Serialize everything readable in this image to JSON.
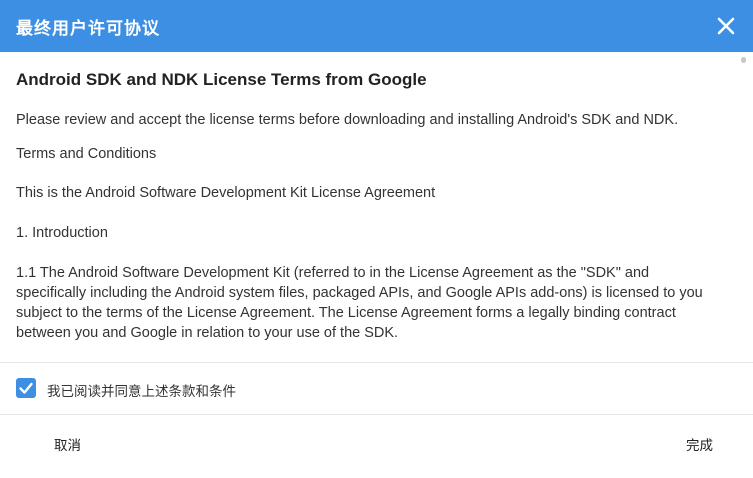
{
  "dialog": {
    "title": "最终用户许可协议",
    "close_icon": "close-icon"
  },
  "license": {
    "heading": "Android SDK and NDK License Terms from Google",
    "intro": "Please review and accept the license terms before downloading and installing Android's SDK and NDK.",
    "terms_title": "Terms and Conditions",
    "agreement_title": "This is the Android Software Development Kit License Agreement",
    "section_1": "1. Introduction",
    "section_1_1": "1.1 The Android Software Development Kit (referred to in the License Agreement as the \"SDK\" and specifically including the Android system files, packaged APIs, and Google APIs add-ons) is licensed to you subject to the terms of the License Agreement. The License Agreement forms a legally binding contract between you and Google in relation to your use of the SDK."
  },
  "agreement": {
    "checked": true,
    "label": "我已阅读并同意上述条款和条件"
  },
  "footer": {
    "cancel_label": "取消",
    "done_label": "完成"
  },
  "colors": {
    "accent": "#3d8fe3"
  }
}
